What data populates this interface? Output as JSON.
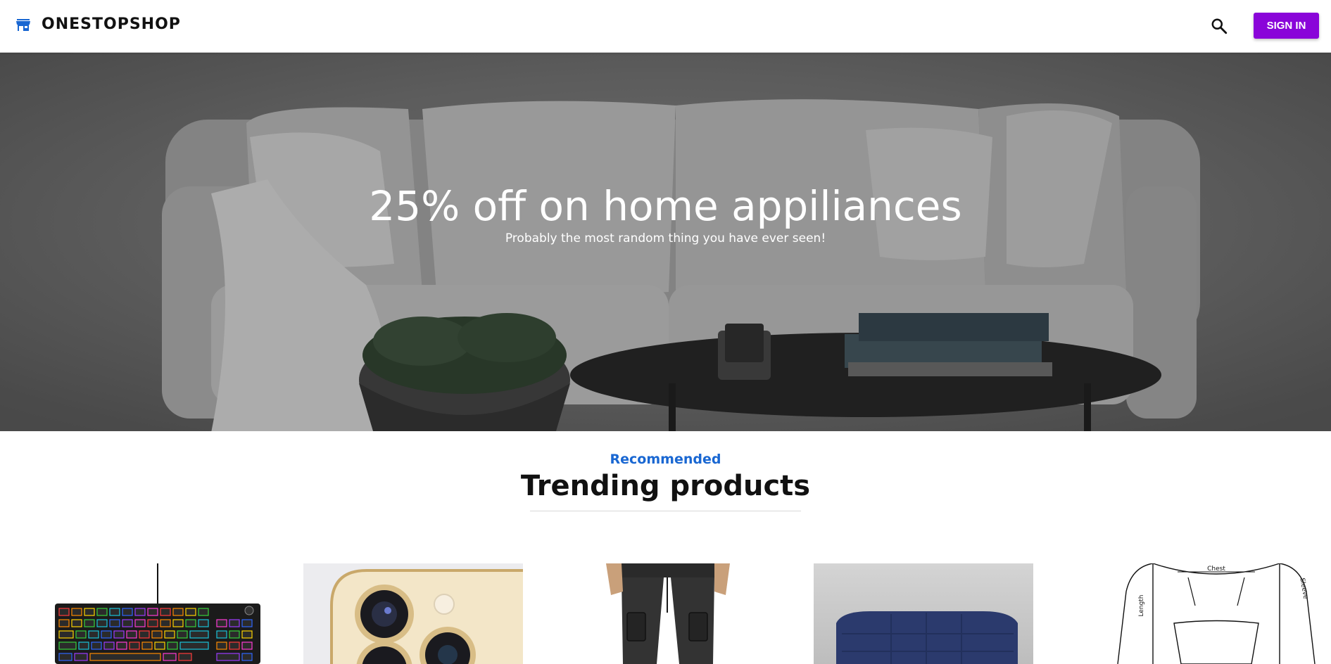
{
  "header": {
    "brand_name": "ONESTOPSHOP",
    "brand_icon": "storefront-icon",
    "search_icon": "search-icon",
    "signin_label": "SIGN IN",
    "accent_color": "#8a05d9",
    "brand_icon_color": "#1967d2"
  },
  "hero": {
    "title": "25% off on home appiliances",
    "subtitle": "Probably the most random thing you have ever seen!"
  },
  "section": {
    "eyebrow": "Recommended",
    "title": "Trending products",
    "eyebrow_color": "#1967d2"
  },
  "products": [
    {
      "image": "rgb-keyboard"
    },
    {
      "image": "smartphone-camera"
    },
    {
      "image": "cargo-pants"
    },
    {
      "image": "blue-sofa"
    },
    {
      "image": "hoodie-size-sketch",
      "sketch_labels": [
        "Chest",
        "Length",
        "Sleeve"
      ]
    }
  ]
}
